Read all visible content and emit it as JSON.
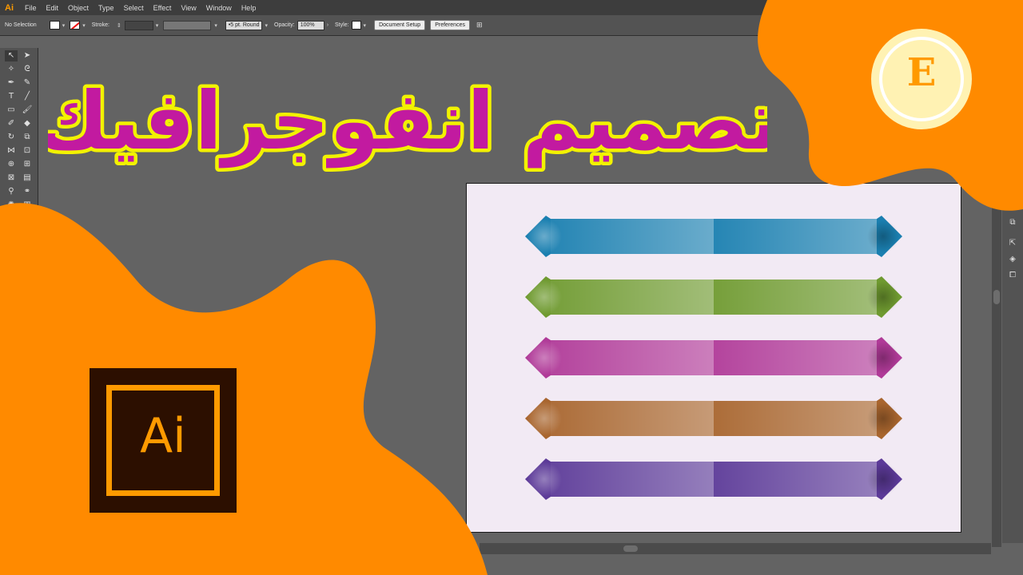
{
  "app": {
    "logo": "Ai",
    "menu": [
      "File",
      "Edit",
      "Object",
      "Type",
      "Select",
      "Effect",
      "View",
      "Window",
      "Help"
    ]
  },
  "controlbar": {
    "selection": "No Selection",
    "stroke_label": "Stroke:",
    "brush": "5 pt. Round",
    "opacity_label": "Opacity:",
    "opacity_value": "100%",
    "style_label": "Style:",
    "document_setup": "Document Setup",
    "preferences": "Preferences"
  },
  "overlay": {
    "title": "تصميم انفوجرافيك",
    "ai_logo_text": "Ai",
    "brand_letter": "E"
  },
  "colors": {
    "orange": "#ff8a00",
    "title_fill": "#c21aa0",
    "title_outline": "#f2f200"
  },
  "artboard": {
    "ribbons": [
      {
        "name": "ribbon-blue",
        "color": "#1a7fb0"
      },
      {
        "name": "ribbon-green",
        "color": "#6f9a30"
      },
      {
        "name": "ribbon-magenta",
        "color": "#b03a98"
      },
      {
        "name": "ribbon-brown",
        "color": "#a8652e"
      },
      {
        "name": "ribbon-purple",
        "color": "#5c3a98"
      }
    ]
  }
}
